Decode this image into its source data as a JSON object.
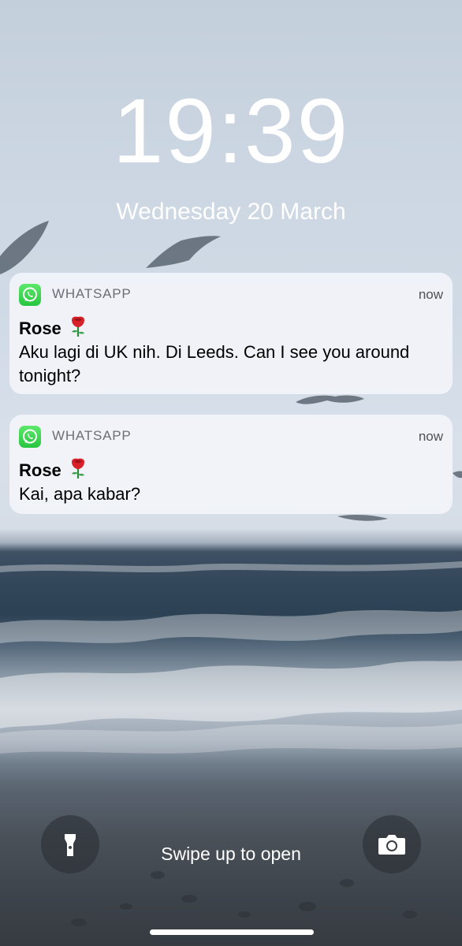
{
  "lockscreen": {
    "time": "19:39",
    "date": "Wednesday 20 March"
  },
  "notifications": [
    {
      "app": "WHATSAPP",
      "app_icon": "whatsapp-icon",
      "time": "now",
      "sender": "Rose",
      "sender_emoji": "rose-icon",
      "message": "Aku lagi di UK nih. Di Leeds. Can I see you around tonight?"
    },
    {
      "app": "WHATSAPP",
      "app_icon": "whatsapp-icon",
      "time": "now",
      "sender": "Rose",
      "sender_emoji": "rose-icon",
      "message": "Kai, apa kabar?"
    }
  ],
  "bottom": {
    "flashlight_icon": "flashlight-icon",
    "camera_icon": "camera-icon",
    "swipe_text": "Swipe up to open"
  },
  "colors": {
    "notification_background": "#f4f6fa",
    "whatsapp_green": "#27c540",
    "app_label": "#6b6f75"
  }
}
